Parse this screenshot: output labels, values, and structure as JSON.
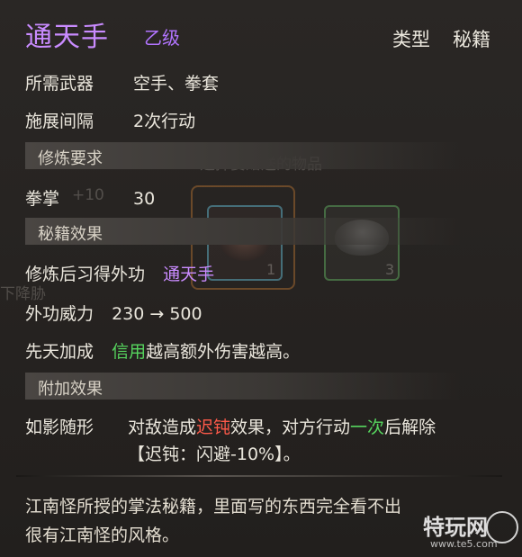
{
  "item": {
    "name": "通天手",
    "grade": "乙级",
    "type_label": "类型",
    "type_value": "秘籍"
  },
  "stats": [
    {
      "key": "所需武器",
      "value": "空手、拳套"
    },
    {
      "key": "施展间隔",
      "value": "2次行动"
    }
  ],
  "sections": {
    "training_req": "修炼要求",
    "manual_effect": "秘籍效果",
    "extra_effect": "附加效果"
  },
  "requirement": {
    "key": "拳掌",
    "value": "30"
  },
  "effects": {
    "learn_label": "修炼后习得外功",
    "learn_value": "通天手",
    "power_label": "外功威力",
    "power_value": "230 → 500",
    "innate_label": "先天加成",
    "innate_highlight": "信用",
    "innate_rest": "越高额外伤害越高。"
  },
  "extra": {
    "name": "如影随形",
    "line1_a": "对敌造成",
    "line1_b": "迟钝",
    "line1_c": "效果，对方行动",
    "line1_d": "一次",
    "line1_e": "后解除",
    "line2": "【迟钝：闪避-10%】。"
  },
  "description": {
    "line1": "江南怪所授的掌法秘籍，里面写的东西完全看不出",
    "line2": "很有江南怪的风格。"
  },
  "background_ghost": {
    "choose_gift": "选择要赠送的物品",
    "count_a": "1",
    "count_b": "3",
    "side_a": "+10",
    "side_b": "下降胁"
  },
  "watermark": {
    "text": "特玩网",
    "url": "www.te5.com"
  }
}
